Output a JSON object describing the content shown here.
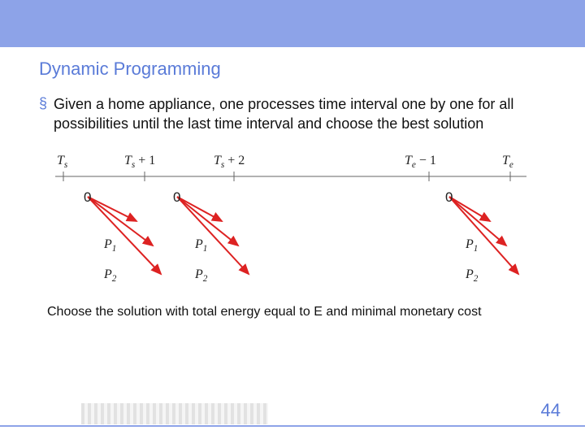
{
  "title": "Dynamic Programming",
  "bullet_glyph": "§",
  "body": "Given a home appliance, one processes time interval one by one for all possibilities until the last time interval and choose the best solution",
  "axis": {
    "t0": "T",
    "t0sub": "s",
    "t1": "T",
    "t1sub": "s",
    "t1suffix": " + 1",
    "t2": "T",
    "t2sub": "s",
    "t2suffix": " + 2",
    "t3": "T",
    "t3sub": "e",
    "t3suffix": " − 1",
    "t4": "T",
    "t4sub": "e"
  },
  "zeros": {
    "a": "0",
    "b": "0",
    "c": "0"
  },
  "plabels": {
    "p1a": "P",
    "p1a_sub": "1",
    "p2a": "P",
    "p2a_sub": "2",
    "p1b": "P",
    "p1b_sub": "1",
    "p2b": "P",
    "p2b_sub": "2",
    "p1c": "P",
    "p1c_sub": "1",
    "p2c": "P",
    "p2c_sub": "2"
  },
  "conclusion": "Choose the solution with total energy equal to E and  minimal monetary cost",
  "page": "44"
}
